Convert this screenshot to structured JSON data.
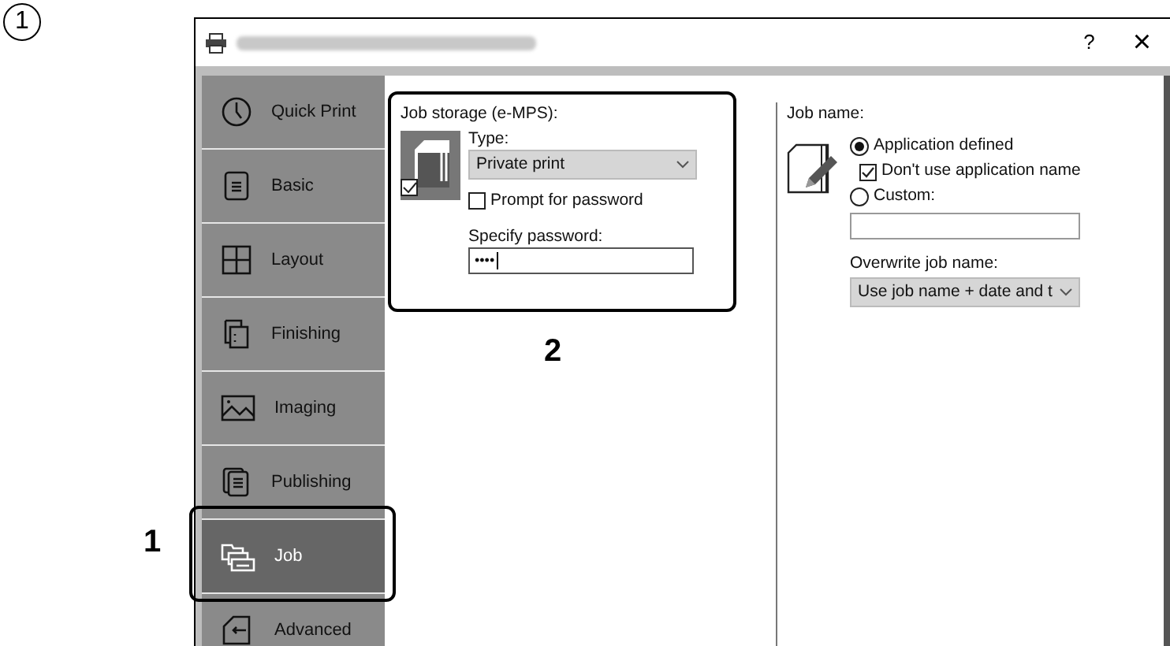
{
  "step_marker": "1",
  "window": {
    "buttons": [
      "?",
      "×"
    ]
  },
  "sidebar": {
    "items": [
      {
        "label": "Quick Print",
        "kind": "clock",
        "selected": false
      },
      {
        "label": "Basic",
        "kind": "document",
        "selected": false
      },
      {
        "label": "Layout",
        "kind": "grid",
        "selected": false
      },
      {
        "label": "Finishing",
        "kind": "finishing",
        "selected": false
      },
      {
        "label": "Imaging",
        "kind": "picture",
        "selected": false
      },
      {
        "label": "Publishing",
        "kind": "pages",
        "selected": false
      },
      {
        "label": "Job",
        "kind": "folders",
        "selected": true
      },
      {
        "label": "Advanced",
        "kind": "advanced",
        "selected": false
      }
    ]
  },
  "callouts": [
    {
      "label": "1"
    },
    {
      "label": "2"
    }
  ],
  "job_storage": {
    "label": "Job storage (e-MPS):",
    "type_label": "Type:",
    "type_value": "Private print",
    "prompt": {
      "label": "Prompt for password",
      "checked": false
    },
    "password_label": "Specify password:",
    "password_value": "••••",
    "enabled": true
  },
  "job_name": {
    "label": "Job name:",
    "options": [
      {
        "label": "Application defined",
        "selected": true
      },
      {
        "label": "Custom:",
        "selected": false
      }
    ],
    "dont_use": {
      "label": "Don't use application name",
      "checked": true
    },
    "overwrite_label": "Overwrite job name:",
    "overwrite_value": "Use job name + date and t"
  }
}
